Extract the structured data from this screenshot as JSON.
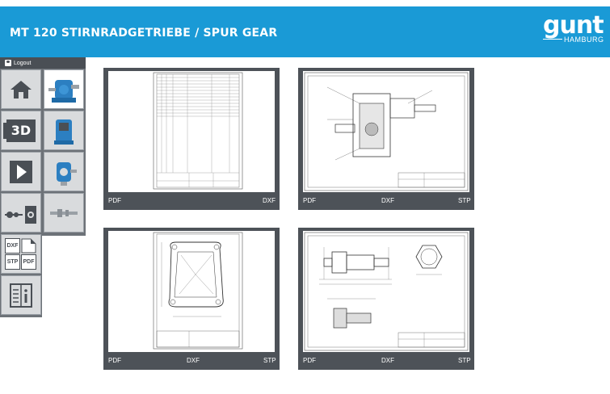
{
  "header": {
    "title": "MT 120 STIRNRADGETRIEBE / SPUR GEAR",
    "logo_text": "gunt",
    "logo_sub": "HAMBURG",
    "bg_color": "#1a9ad6"
  },
  "session": {
    "logout_label": "Logout"
  },
  "sidebar": {
    "items": [
      {
        "name": "home",
        "icon": "home-icon"
      },
      {
        "name": "3d",
        "label": "3D",
        "icon": "3d-icon"
      },
      {
        "name": "video",
        "icon": "play-icon"
      },
      {
        "name": "assembly",
        "icon": "assembly-icon"
      },
      {
        "name": "formats",
        "labels": [
          "DXF",
          "STP",
          "PDF"
        ],
        "icon": "file-formats-icon"
      },
      {
        "name": "info",
        "icon": "info-icon"
      }
    ]
  },
  "submenu": {
    "items": [
      {
        "name": "gearbox-full",
        "icon": "gearbox-icon",
        "active": true
      },
      {
        "name": "gearbox-side",
        "icon": "gearbox-side-icon"
      },
      {
        "name": "gearbox-housing",
        "icon": "housing-icon"
      },
      {
        "name": "shaft",
        "icon": "shaft-icon"
      }
    ]
  },
  "drawings": [
    {
      "name": "parts-list",
      "formats": [
        "PDF",
        "DXF"
      ]
    },
    {
      "name": "assembly-section",
      "formats": [
        "PDF",
        "DXF",
        "STP"
      ]
    },
    {
      "name": "housing-flange",
      "formats": [
        "PDF",
        "DXF",
        "STP"
      ]
    },
    {
      "name": "shaft-details",
      "formats": [
        "PDF",
        "DXF",
        "STP"
      ]
    }
  ]
}
